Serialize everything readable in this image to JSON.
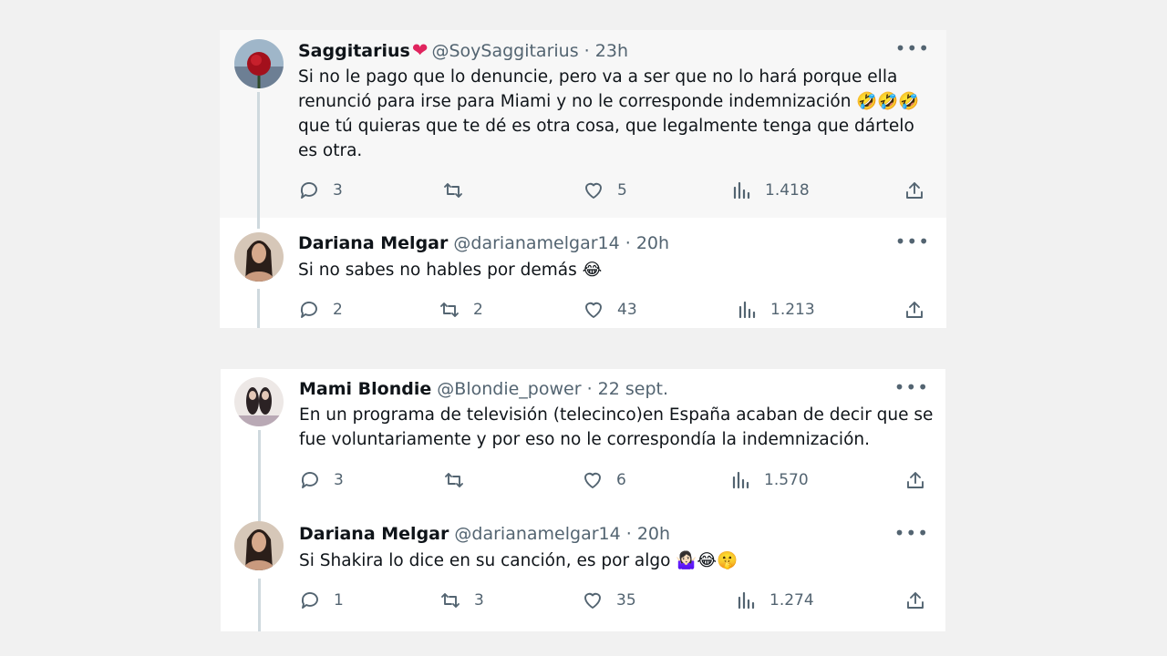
{
  "threads": [
    {
      "tweets": [
        {
          "name": "Saggitarius",
          "verified_heart": "❤",
          "handle": "@SoySaggitarius",
          "sep": "·",
          "time": "23h",
          "more": "•••",
          "text": "Si no le pago que lo denuncie, pero va a ser que no lo hará porque ella renunció para irse para Miami y no le corresponde indemnización 🤣🤣🤣 que tú quieras que te dé es otra cosa, que legalmente tenga que dártelo es otra.",
          "replies": "3",
          "retweets": "",
          "likes": "5",
          "views": "1.418"
        },
        {
          "name": "Dariana Melgar",
          "handle": "@darianamelgar14",
          "sep": "·",
          "time": "20h",
          "more": "•••",
          "text": "Si no sabes no hables por demás 😂",
          "replies": "2",
          "retweets": "2",
          "likes": "43",
          "views": "1.213"
        }
      ]
    },
    {
      "tweets": [
        {
          "name": "Mami Blondie",
          "handle": "@Blondie_power",
          "sep": "·",
          "time": "22 sept.",
          "more": "•••",
          "text": "En un programa de televisión (telecinco)en España acaban de decir que se fue voluntariamente y por eso no le correspondía la indemnización.",
          "replies": "3",
          "retweets": "",
          "likes": "6",
          "views": "1.570"
        },
        {
          "name": "Dariana Melgar",
          "handle": "@darianamelgar14",
          "sep": "·",
          "time": "20h",
          "more": "•••",
          "text": "Si Shakira lo dice en su canción, es por algo 🤷🏻‍♀️😂🤫",
          "replies": "1",
          "retweets": "3",
          "likes": "35",
          "views": "1.274"
        }
      ]
    }
  ],
  "colors": {
    "background": "#f1f1f1",
    "card": "#ffffff",
    "highlight": "#f7f7f7",
    "text": "#0f1419",
    "secondary": "#536471",
    "thread_line": "#cfd9de",
    "heart": "#e0245e"
  },
  "icons": [
    "reply-icon",
    "retweet-icon",
    "like-icon",
    "views-icon",
    "share-icon",
    "more-icon"
  ]
}
